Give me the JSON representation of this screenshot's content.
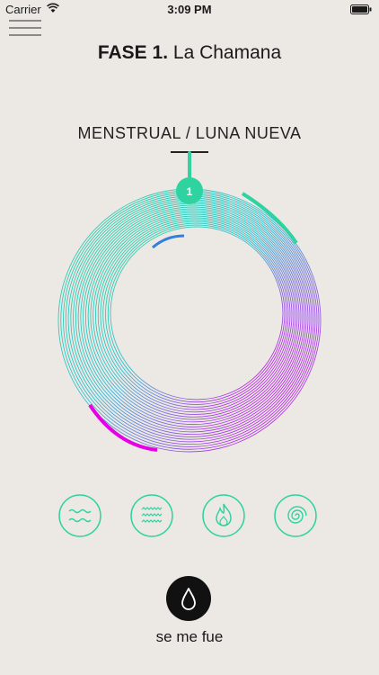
{
  "status_bar": {
    "carrier": "Carrier",
    "time": "3:09 PM"
  },
  "header": {
    "phase_prefix": "FASE 1.",
    "phase_name": "La Chamana"
  },
  "cycle": {
    "phase_label": "MENSTRUAL / LUNA NUEVA",
    "marker_number": "1"
  },
  "colors": {
    "background": "#ece9e5",
    "accent_green": "#2ed3a0",
    "accent_blue": "#2f7fe0",
    "accent_magenta": "#e600e6",
    "ring_teal": "#33cccc",
    "ring_purple": "#9a5ce0",
    "drop_button": "#111111"
  },
  "elements": {
    "icons": [
      "water-waves-icon",
      "air-waves-icon",
      "fire-icon",
      "spiral-icon"
    ]
  },
  "action": {
    "label": "se me fue",
    "icon": "drop-icon"
  }
}
